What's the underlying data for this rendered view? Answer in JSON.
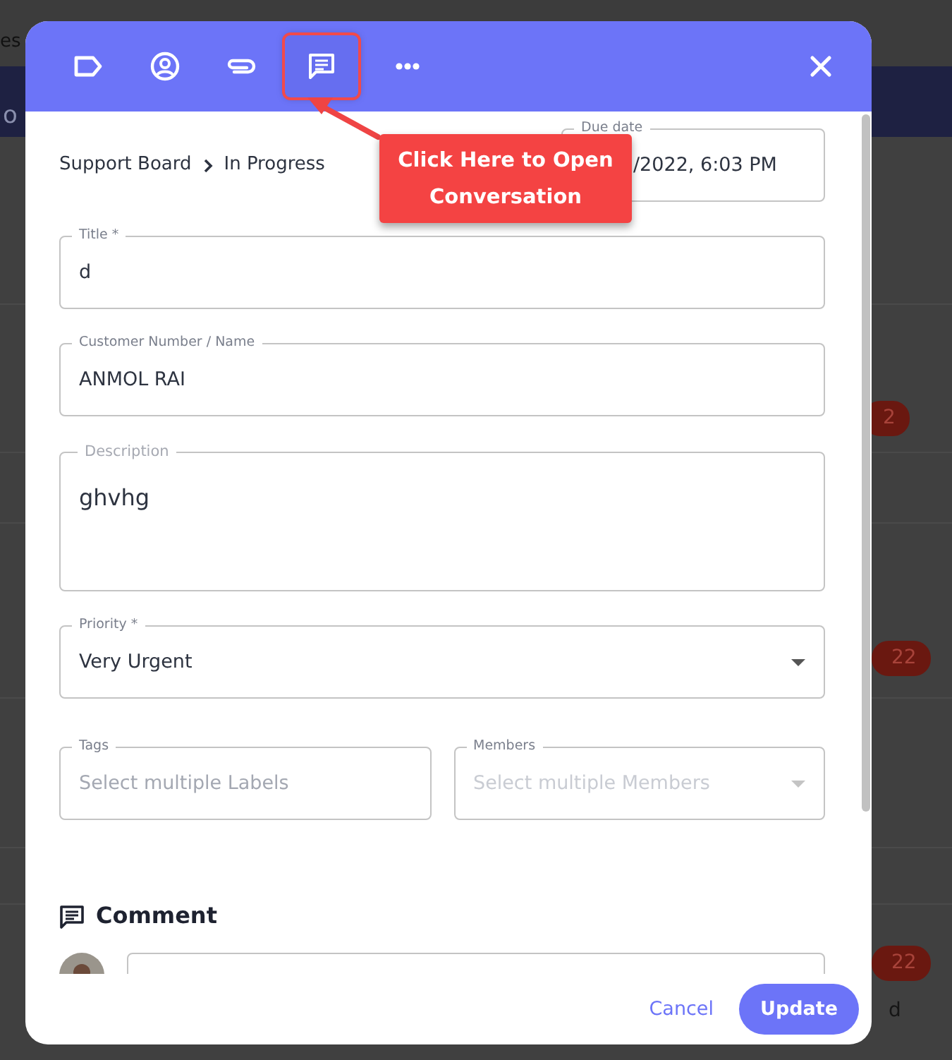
{
  "backdrop": {
    "header_text": "es",
    "banner_text": "o",
    "badges": [
      "2",
      "22",
      "22"
    ],
    "row_text": "d"
  },
  "toolbar": [
    {
      "kind": "label",
      "selected": false
    },
    {
      "kind": "account",
      "selected": false
    },
    {
      "kind": "attach",
      "selected": false
    },
    {
      "kind": "comment",
      "selected": true
    },
    {
      "kind": "more",
      "selected": false
    }
  ],
  "callout": {
    "text": "Click Here to Open Conversation"
  },
  "breadcrumb": [
    "Support Board",
    "In Progress"
  ],
  "due_date": {
    "label": "Due date",
    "value": "/2022, 6:03 PM"
  },
  "fields": [
    {
      "kind": "text",
      "label": "Title *",
      "value": "d"
    },
    {
      "kind": "text",
      "label": "Customer Number / Name",
      "value": "ANMOL RAI"
    },
    {
      "kind": "textarea",
      "label": "Description",
      "value": "ghvhg"
    },
    {
      "kind": "select",
      "label": "Priority *",
      "value": "Very Urgent"
    }
  ],
  "pickers": [
    {
      "label": "Tags",
      "placeholder": "Select multiple Labels",
      "disabled": false
    },
    {
      "label": "Members",
      "placeholder": "Select multiple Members",
      "disabled": true
    }
  ],
  "comment": {
    "heading": "Comment"
  },
  "footer": {
    "cancel": "Cancel",
    "update": "Update"
  }
}
